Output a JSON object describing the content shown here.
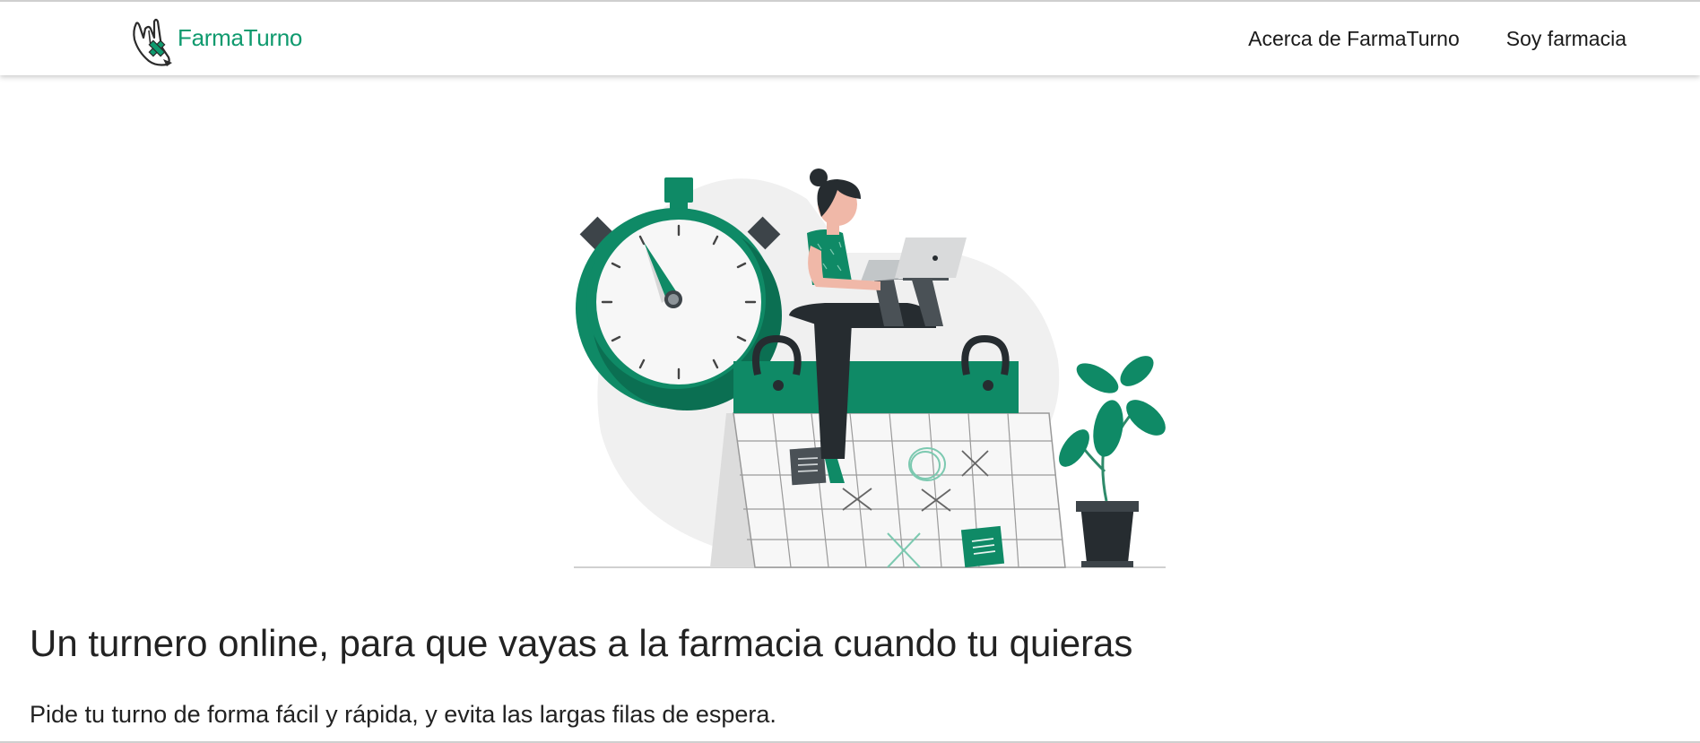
{
  "brand": {
    "name": "FarmaTurno",
    "color": "#0f9a6e"
  },
  "nav": {
    "links": [
      {
        "label": "Acerca de FarmaTurno"
      },
      {
        "label": "Soy farmacia"
      }
    ]
  },
  "hero": {
    "illustration": "woman-with-laptop-sitting-on-calendar-next-to-stopwatch-and-plant",
    "headline": "Un turnero online, para que vayas a la farmacia cuando tu quieras",
    "subline": "Pide tu turno de forma fácil y rápida, y evita las largas filas de espera."
  },
  "colors": {
    "accent_green": "#0f8a66",
    "dark_gray": "#2d3338",
    "light_gray": "#efefef"
  }
}
